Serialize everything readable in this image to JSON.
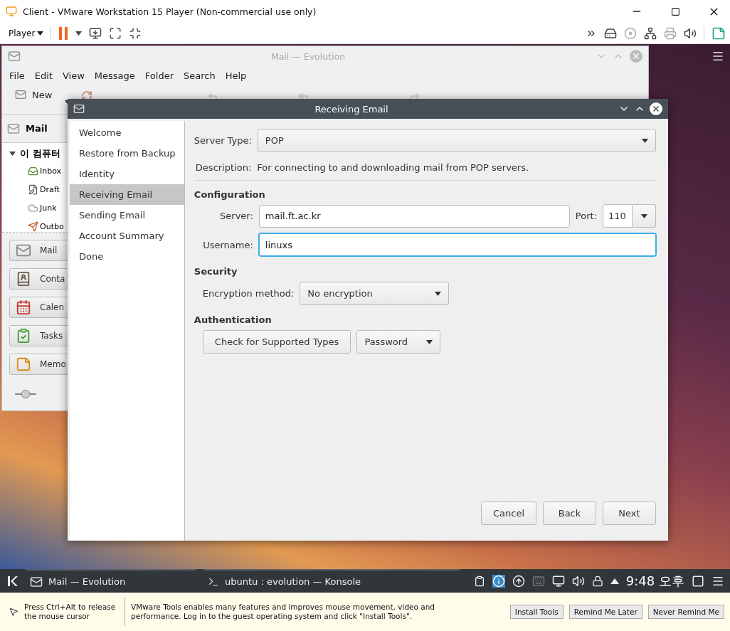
{
  "vm_window": {
    "title": "Client - VMware Workstation 15 Player (Non-commercial use only)",
    "player_menu": "Player"
  },
  "evolution": {
    "title": "Mail — Evolution",
    "menu": [
      "File",
      "Edit",
      "View",
      "Message",
      "Folder",
      "Search",
      "Help"
    ],
    "toolbar": [
      {
        "label": "New",
        "disabled": false
      },
      {
        "disabled": false
      },
      {
        "disabled": true
      },
      {
        "disabled": true
      },
      {
        "disabled": true
      }
    ],
    "sidebar_title": "Mail",
    "tree": {
      "label": "이 컴퓨터",
      "expanded": true,
      "children": [
        {
          "label": "Inbox",
          "kind": "inbox"
        },
        {
          "label": "Draft",
          "kind": "drafts"
        },
        {
          "label": "Junk",
          "kind": "junk"
        },
        {
          "label": "Outbo",
          "kind": "outbox"
        }
      ]
    },
    "switcher": [
      {
        "label": "Mail",
        "kind": "mail"
      },
      {
        "label": "Conta",
        "kind": "contacts"
      },
      {
        "label": "Calen",
        "kind": "calendar"
      },
      {
        "label": "Tasks",
        "kind": "tasks"
      },
      {
        "label": "Memo",
        "kind": "memos"
      }
    ]
  },
  "dialog": {
    "title": "Receiving Email",
    "steps": [
      {
        "label": "Welcome",
        "selected": false
      },
      {
        "label": "Restore from Backup",
        "selected": false
      },
      {
        "label": "Identity",
        "selected": false
      },
      {
        "label": "Receiving Email",
        "selected": true
      },
      {
        "label": "Sending Email",
        "selected": false
      },
      {
        "label": "Account Summary",
        "selected": false
      },
      {
        "label": "Done",
        "selected": false
      }
    ],
    "server_type": {
      "label": "Server Type:",
      "value": "POP"
    },
    "description": {
      "label": "Description:",
      "text": "For connecting to and downloading mail from POP servers."
    },
    "configuration": {
      "heading": "Configuration",
      "server_label": "Server:",
      "server": "mail.ft.ac.kr",
      "port_label": "Port:",
      "port": "110",
      "username_label": "Username:",
      "username": "linuxs",
      "username_focused": true
    },
    "security": {
      "heading": "Security",
      "encryption_label": "Encryption method:",
      "encryption": "No encryption"
    },
    "authentication": {
      "heading": "Authentication",
      "check_button": "Check for Supported Types",
      "method": "Password"
    },
    "buttons": [
      "Cancel",
      "Back",
      "Next"
    ]
  },
  "taskbar": {
    "tasks": [
      "Mail — Evolution",
      "ubuntu : evolution — Konsole"
    ],
    "clock": "9:48 오후"
  },
  "vmware_bar": {
    "hint": "Press Ctrl+Alt to release the mouse cursor",
    "message": "VMware Tools enables many features and improves mouse movement, video and performance. Log in to the guest operating system and click \"Install Tools\".",
    "buttons": [
      "Install Tools",
      "Remind Me Later",
      "Never Remind Me"
    ]
  }
}
